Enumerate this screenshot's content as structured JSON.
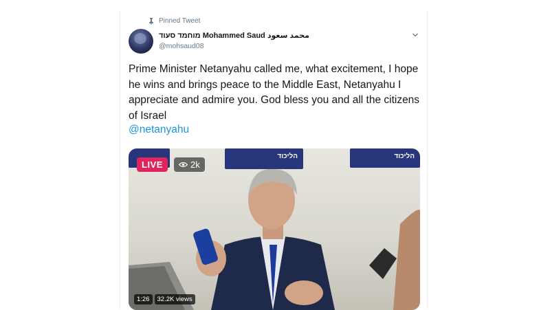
{
  "tweet": {
    "pinned_label": "Pinned Tweet",
    "display_name": "מוחמד סעוד Mohammed Saud محمد سعود",
    "handle": "@mohsaud08",
    "text": "Prime Minister Netanyahu called me, what excitement, I hope he wins and brings peace to the Middle East, Netanyahu I appreciate and admire you. God bless you and all the citizens of Israel",
    "mention": "@netanyahu"
  },
  "video": {
    "live_label": "LIVE",
    "viewer_count": "2k",
    "duration": "1:26",
    "views": "32.2K views",
    "banner_text": "הליכוד"
  },
  "colors": {
    "accent": "#1b95e0",
    "live": "#e0245e",
    "secondary_text": "#657786"
  },
  "icons": [
    "pin-icon",
    "chevron-down-icon",
    "eye-icon"
  ]
}
